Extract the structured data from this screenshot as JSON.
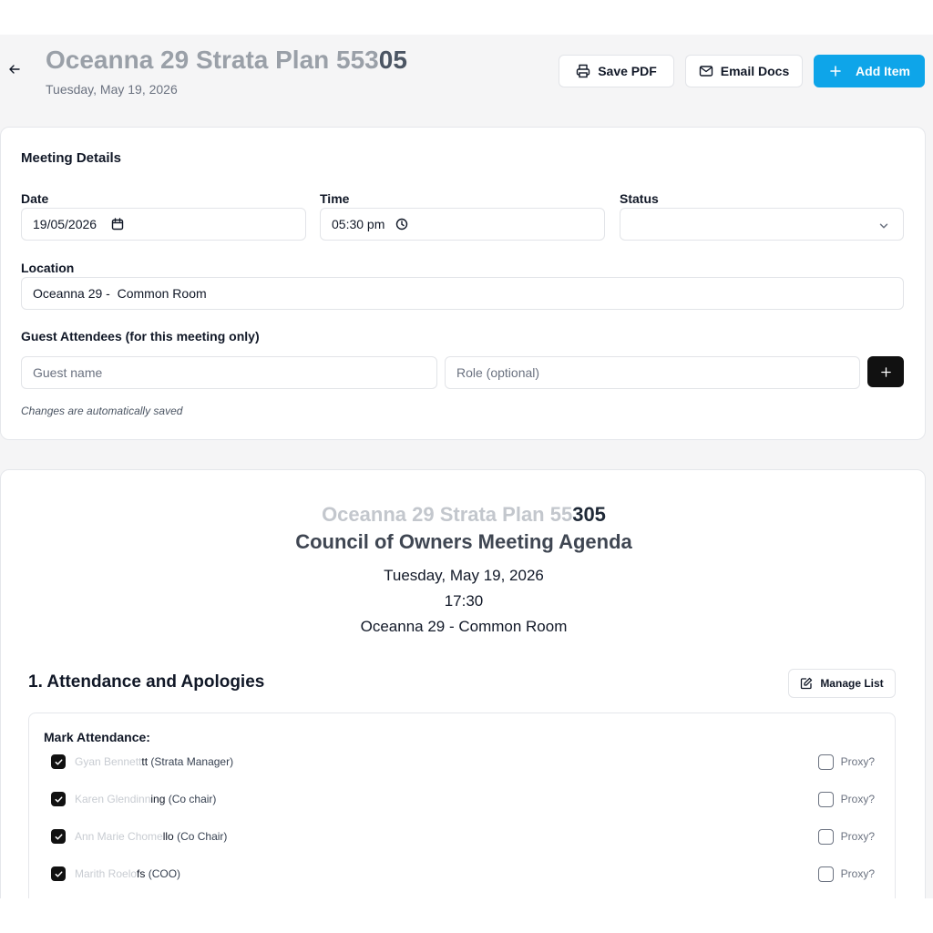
{
  "header": {
    "back_icon": "arrow-left-icon",
    "title_faded": "Oceanna 29 Strata Plan 553",
    "title_strong": "05",
    "date": "Tuesday, May 19, 2026",
    "buttons": {
      "save_pdf": "Save PDF",
      "email_docs": "Email Docs",
      "add_item": "Add Item"
    }
  },
  "meeting_details": {
    "title": "Meeting Details",
    "date_label": "Date",
    "date_value": "19/05/2026",
    "time_label": "Time",
    "time_value": "05:30 pm",
    "status_label": "Status",
    "status_value": "",
    "location_label": "Location",
    "location_value": "Oceanna 29 -  Common Room",
    "guests_label": "Guest Attendees (for this meeting only)",
    "guest_name_placeholder": "Guest name",
    "guest_role_placeholder": "Role (optional)",
    "autosave_note": "Changes are automatically saved"
  },
  "agenda": {
    "building_faded": "Oceanna 29 Strata Plan 55",
    "building_strong": "305",
    "title": "Council of Owners Meeting Agenda",
    "date": "Tuesday, May 19, 2026",
    "time": "17:30",
    "location": "Oceanna 29 - Common Room",
    "item_heading": "1. Attendance and Apologies",
    "manage_list": "Manage List",
    "mark_attendance": "Mark Attendance:",
    "proxy_label": "Proxy?",
    "attendees": [
      {
        "faded": "Gyan Bennett",
        "strong": "tt",
        "suffix": " (Strata Manager)",
        "present": true,
        "proxy": false
      },
      {
        "faded": "Karen Glendinn",
        "strong": "ing",
        "suffix": " (Co chair)",
        "present": true,
        "proxy": false
      },
      {
        "faded": "Ann Marie Chome",
        "strong": "llo",
        "suffix": " (Co Chair)",
        "present": true,
        "proxy": false
      },
      {
        "faded": "Marith Roelo",
        "strong": "fs",
        "suffix": " (COO)",
        "present": true,
        "proxy": false
      }
    ]
  },
  "colors": {
    "primary": "#0ea5e9",
    "dark_button": "#111111",
    "background": "#f5f5f6"
  }
}
